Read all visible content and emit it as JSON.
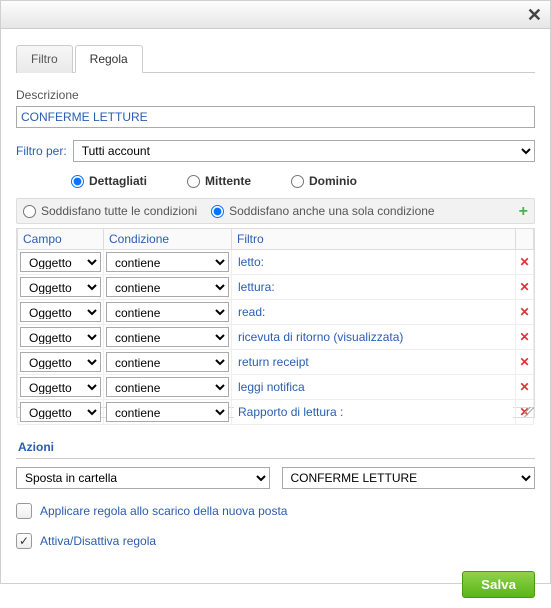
{
  "header": {
    "close_glyph": "✕"
  },
  "tabs": {
    "filter": "Filtro",
    "rule": "Regola",
    "active": "rule"
  },
  "description": {
    "label": "Descrizione",
    "value": "CONFERME LETTURE"
  },
  "filter_for": {
    "label": "Filtro per:",
    "selected": "Tutti account",
    "options": [
      "Tutti account"
    ]
  },
  "type_radios": {
    "detailed": "Dettagliati",
    "sender": "Mittente",
    "domain": "Dominio",
    "selected": "detailed"
  },
  "cond_mode": {
    "all": "Soddisfano tutte le condizioni",
    "any": "Soddisfano anche una sola condizione",
    "selected": "any"
  },
  "plus_glyph": "+",
  "grid": {
    "headers": {
      "field": "Campo",
      "condition": "Condizione",
      "filter": "Filtro"
    },
    "field_options": [
      "Oggetto"
    ],
    "cond_options": [
      "contiene"
    ],
    "delete_glyph": "✕",
    "rows": [
      {
        "field": "Oggetto",
        "cond": "contiene",
        "filter": "letto:"
      },
      {
        "field": "Oggetto",
        "cond": "contiene",
        "filter": "lettura:"
      },
      {
        "field": "Oggetto",
        "cond": "contiene",
        "filter": "read:"
      },
      {
        "field": "Oggetto",
        "cond": "contiene",
        "filter": "ricevuta di ritorno (visualizzata)"
      },
      {
        "field": "Oggetto",
        "cond": "contiene",
        "filter": "return receipt"
      },
      {
        "field": "Oggetto",
        "cond": "contiene",
        "filter": "leggi notifica"
      },
      {
        "field": "Oggetto",
        "cond": "contiene",
        "filter": "Rapporto di lettura :"
      }
    ]
  },
  "actions": {
    "heading": "Azioni",
    "action_selected": "Sposta in cartella",
    "action_options": [
      "Sposta in cartella"
    ],
    "target_selected": "CONFERME LETTURE",
    "target_options": [
      "CONFERME LETTURE"
    ]
  },
  "opts": {
    "apply_on_download": {
      "label": "Applicare regola allo scarico della nuova posta",
      "checked": false
    },
    "enable_rule": {
      "label": "Attiva/Disattiva regola",
      "checked": true
    }
  },
  "save_label": "Salva"
}
